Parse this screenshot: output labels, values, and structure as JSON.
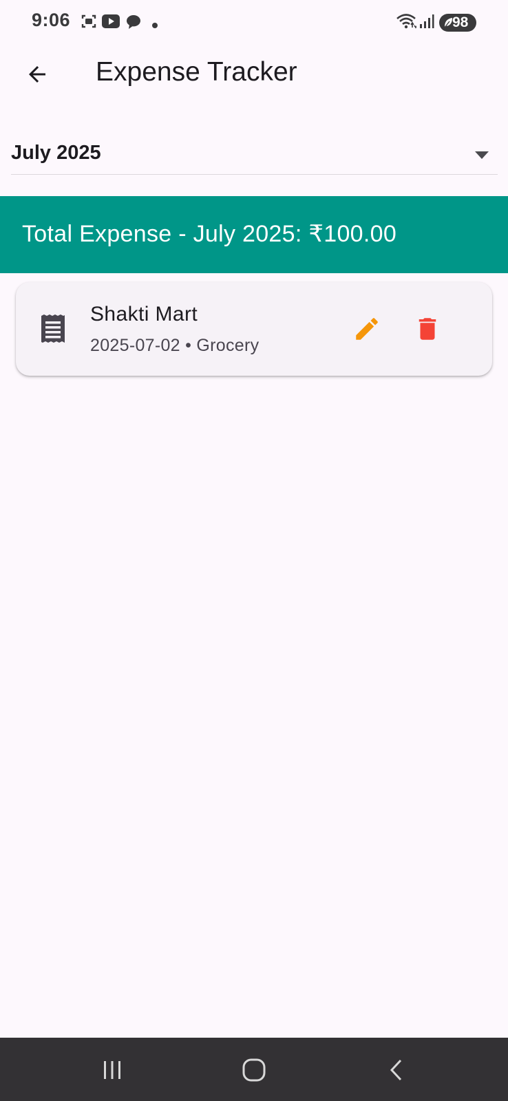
{
  "status_bar": {
    "time": "9:06",
    "battery": "98",
    "icons": [
      "screenshot-icon",
      "youtube-icon",
      "chat-icon",
      "dot-icon",
      "wifi-icon",
      "signal-icon",
      "battery-icon"
    ]
  },
  "app_bar": {
    "title": "Expense Tracker",
    "back_icon": "arrow-back-icon"
  },
  "month_selector": {
    "selected": "July 2025",
    "arrow_icon": "dropdown-arrow-icon"
  },
  "summary": {
    "total_text": "Total Expense - July 2025: ₹100.00",
    "background_color": "#009688"
  },
  "expenses": [
    {
      "name": "Shakti Mart",
      "meta": "2025-07-02 • Grocery",
      "icon": "receipt-icon",
      "edit_icon": "edit-icon",
      "delete_icon": "delete-icon"
    }
  ],
  "colors": {
    "edit": "#f5960a",
    "delete": "#f44336",
    "accent": "#009688"
  },
  "nav_bar": {
    "buttons": [
      "recent-apps-icon",
      "home-icon",
      "back-icon"
    ]
  }
}
